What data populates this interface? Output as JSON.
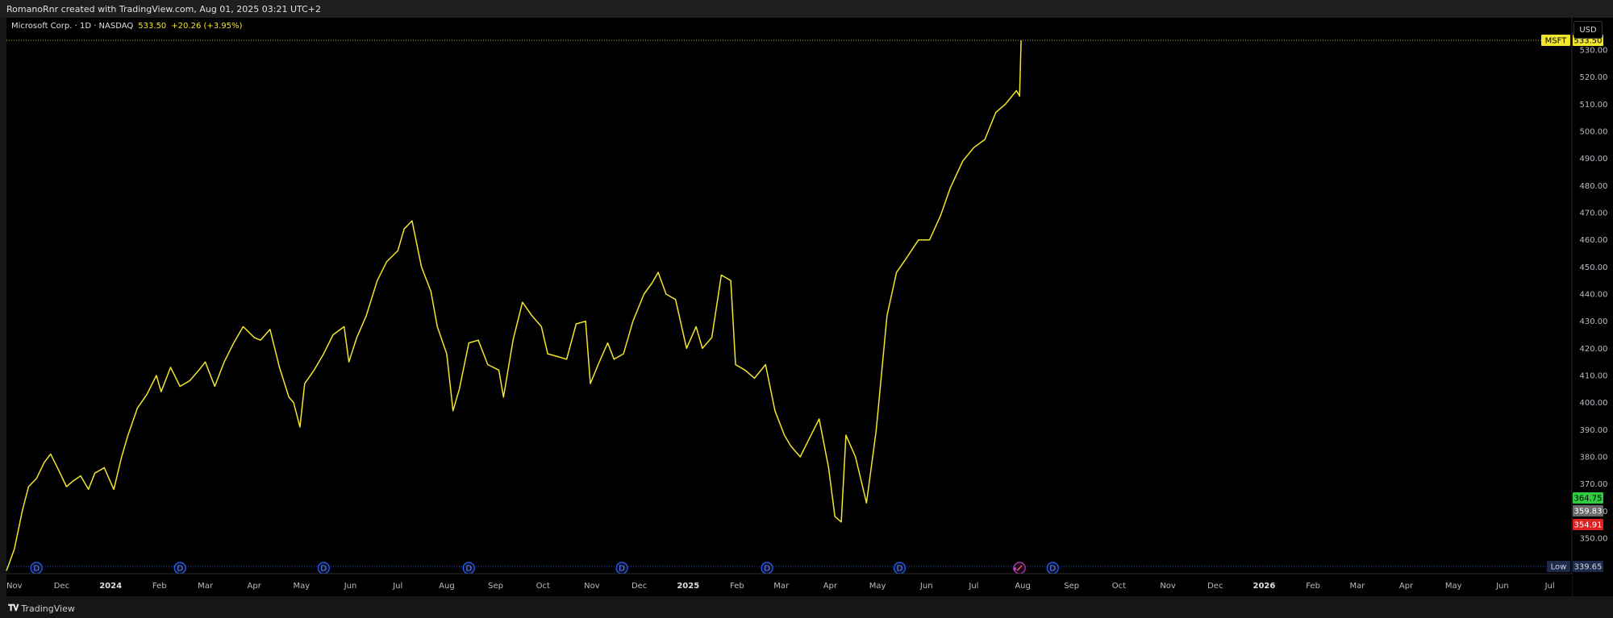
{
  "header": {
    "credit": "RomanoRnr created with TradingView.com, Aug 01, 2025 03:21 UTC+2"
  },
  "legend": {
    "symbol_line": "Microsoft Corp. · 1D · NASDAQ",
    "last_price": "533.50",
    "change": "+20.26 (+3.95%)"
  },
  "price_scale": {
    "currency": "USD",
    "ticks": [
      "530.00",
      "520.00",
      "510.00",
      "500.00",
      "490.00",
      "480.00",
      "470.00",
      "460.00",
      "450.00",
      "440.00",
      "430.00",
      "420.00",
      "410.00",
      "400.00",
      "390.00",
      "380.00",
      "370.00",
      "360.00",
      "350.00"
    ],
    "badges": [
      {
        "label": "MSFT",
        "value": "533.50",
        "color": "#f2e52e",
        "text_color": "#000000"
      },
      {
        "label": "",
        "value": "364.75",
        "color": "#2ecc40",
        "text_color": "#000000"
      },
      {
        "label": "",
        "value": "359.83",
        "color": "#6b6b6b",
        "text_color": "#ffffff"
      },
      {
        "label": "",
        "value": "354.91",
        "color": "#e02020",
        "text_color": "#ffffff"
      },
      {
        "label": "Low",
        "value": "339.65",
        "color": "#1e2a4a",
        "text_color": "#d1d4dc"
      }
    ]
  },
  "time_axis": {
    "labels": [
      {
        "text": "Nov",
        "year": false
      },
      {
        "text": "Dec",
        "year": false
      },
      {
        "text": "2024",
        "year": true
      },
      {
        "text": "Feb",
        "year": false
      },
      {
        "text": "Mar",
        "year": false
      },
      {
        "text": "Apr",
        "year": false
      },
      {
        "text": "May",
        "year": false
      },
      {
        "text": "Jun",
        "year": false
      },
      {
        "text": "Jul",
        "year": false
      },
      {
        "text": "Aug",
        "year": false
      },
      {
        "text": "Sep",
        "year": false
      },
      {
        "text": "Oct",
        "year": false
      },
      {
        "text": "Nov",
        "year": false
      },
      {
        "text": "Dec",
        "year": false
      },
      {
        "text": "2025",
        "year": true
      },
      {
        "text": "Feb",
        "year": false
      },
      {
        "text": "Mar",
        "year": false
      },
      {
        "text": "Apr",
        "year": false
      },
      {
        "text": "May",
        "year": false
      },
      {
        "text": "Jun",
        "year": false
      },
      {
        "text": "Jul",
        "year": false
      },
      {
        "text": "Aug",
        "year": false
      },
      {
        "text": "Sep",
        "year": false
      },
      {
        "text": "Oct",
        "year": false
      },
      {
        "text": "Nov",
        "year": false
      },
      {
        "text": "Dec",
        "year": false
      },
      {
        "text": "2026",
        "year": true
      },
      {
        "text": "Feb",
        "year": false
      },
      {
        "text": "Mar",
        "year": false
      },
      {
        "text": "Apr",
        "year": false
      },
      {
        "text": "May",
        "year": false
      },
      {
        "text": "Jun",
        "year": false
      },
      {
        "text": "Jul",
        "year": false
      }
    ]
  },
  "event_markers": {
    "dividend_label": "D",
    "dividend_dates": [
      "2023-11-15",
      "2024-02-14",
      "2024-05-15",
      "2024-08-15",
      "2024-11-20",
      "2025-02-20",
      "2025-05-15",
      "2025-08-20"
    ],
    "earnings_date": "2025-07-30"
  },
  "footer": {
    "brand": "TradingView"
  },
  "colors": {
    "line": "#f2e52e",
    "background": "#000000",
    "marker": "#2962ff",
    "earnings": "#c040c0"
  },
  "chart_data": {
    "type": "line",
    "title": "Microsoft Corp. · 1D · NASDAQ",
    "xlabel": "",
    "ylabel": "",
    "ylim": [
      339.65,
      534
    ],
    "xlim": [
      "2023-10-27",
      "2026-07-15"
    ],
    "grid": false,
    "series": [
      {
        "name": "MSFT",
        "x": [
          "2023-10-27",
          "2023-11-01",
          "2023-11-06",
          "2023-11-10",
          "2023-11-15",
          "2023-11-20",
          "2023-11-24",
          "2023-11-30",
          "2023-12-04",
          "2023-12-08",
          "2023-12-13",
          "2023-12-18",
          "2023-12-22",
          "2023-12-28",
          "2024-01-03",
          "2024-01-08",
          "2024-01-12",
          "2024-01-18",
          "2024-01-24",
          "2024-01-30",
          "2024-02-02",
          "2024-02-08",
          "2024-02-14",
          "2024-02-20",
          "2024-02-26",
          "2024-03-01",
          "2024-03-07",
          "2024-03-13",
          "2024-03-19",
          "2024-03-25",
          "2024-04-01",
          "2024-04-05",
          "2024-04-11",
          "2024-04-17",
          "2024-04-23",
          "2024-04-26",
          "2024-04-30",
          "2024-05-03",
          "2024-05-09",
          "2024-05-15",
          "2024-05-21",
          "2024-05-28",
          "2024-05-31",
          "2024-06-05",
          "2024-06-11",
          "2024-06-18",
          "2024-06-24",
          "2024-07-01",
          "2024-07-05",
          "2024-07-10",
          "2024-07-16",
          "2024-07-22",
          "2024-07-26",
          "2024-08-01",
          "2024-08-05",
          "2024-08-09",
          "2024-08-15",
          "2024-08-21",
          "2024-08-27",
          "2024-09-03",
          "2024-09-06",
          "2024-09-12",
          "2024-09-18",
          "2024-09-24",
          "2024-09-30",
          "2024-10-04",
          "2024-10-10",
          "2024-10-16",
          "2024-10-22",
          "2024-10-28",
          "2024-10-31",
          "2024-11-05",
          "2024-11-11",
          "2024-11-15",
          "2024-11-21",
          "2024-11-27",
          "2024-12-04",
          "2024-12-09",
          "2024-12-13",
          "2024-12-18",
          "2024-12-24",
          "2024-12-31",
          "2025-01-06",
          "2025-01-10",
          "2025-01-16",
          "2025-01-22",
          "2025-01-28",
          "2025-01-31",
          "2025-02-06",
          "2025-02-12",
          "2025-02-19",
          "2025-02-25",
          "2025-03-03",
          "2025-03-07",
          "2025-03-13",
          "2025-03-19",
          "2025-03-25",
          "2025-03-31",
          "2025-04-04",
          "2025-04-08",
          "2025-04-11",
          "2025-04-17",
          "2025-04-24",
          "2025-04-30",
          "2025-05-01",
          "2025-05-07",
          "2025-05-13",
          "2025-05-19",
          "2025-05-27",
          "2025-06-03",
          "2025-06-10",
          "2025-06-16",
          "2025-06-24",
          "2025-07-01",
          "2025-07-08",
          "2025-07-15",
          "2025-07-21",
          "2025-07-28",
          "2025-07-30",
          "2025-07-31"
        ],
        "values": [
          338.0,
          346.0,
          360.0,
          369.0,
          372.0,
          378.0,
          381.0,
          374.0,
          369.0,
          371.0,
          373.0,
          368.0,
          374.0,
          376.0,
          368.0,
          380.0,
          388.0,
          398.0,
          403.0,
          410.0,
          404.0,
          413.0,
          406.0,
          408.0,
          412.0,
          415.0,
          406.0,
          415.0,
          422.0,
          428.0,
          424.0,
          423.0,
          427.0,
          413.0,
          402.0,
          400.0,
          391.0,
          407.0,
          412.0,
          418.0,
          425.0,
          428.0,
          415.0,
          424.0,
          432.0,
          445.0,
          452.0,
          456.0,
          464.0,
          467.0,
          450.0,
          441.0,
          428.0,
          418.0,
          397.0,
          405.0,
          422.0,
          423.0,
          414.0,
          412.0,
          402.0,
          423.0,
          437.0,
          432.0,
          428.0,
          418.0,
          417.0,
          416.0,
          429.0,
          430.0,
          407.0,
          414.0,
          422.0,
          416.0,
          418.0,
          430.0,
          440.0,
          444.0,
          448.0,
          440.0,
          438.0,
          420.0,
          428.0,
          420.0,
          424.0,
          447.0,
          445.0,
          414.0,
          412.0,
          409.0,
          414.0,
          397.0,
          388.0,
          384.0,
          380.0,
          387.0,
          394.0,
          376.0,
          358.0,
          356.0,
          388.0,
          380.0,
          363.0,
          389.0,
          395.0,
          432.0,
          448.0,
          453.0,
          460.0,
          460.0,
          469.0,
          479.0,
          489.0,
          494.0,
          497.0,
          507.0,
          510.0,
          515.0,
          513.0,
          533.5
        ]
      }
    ]
  }
}
